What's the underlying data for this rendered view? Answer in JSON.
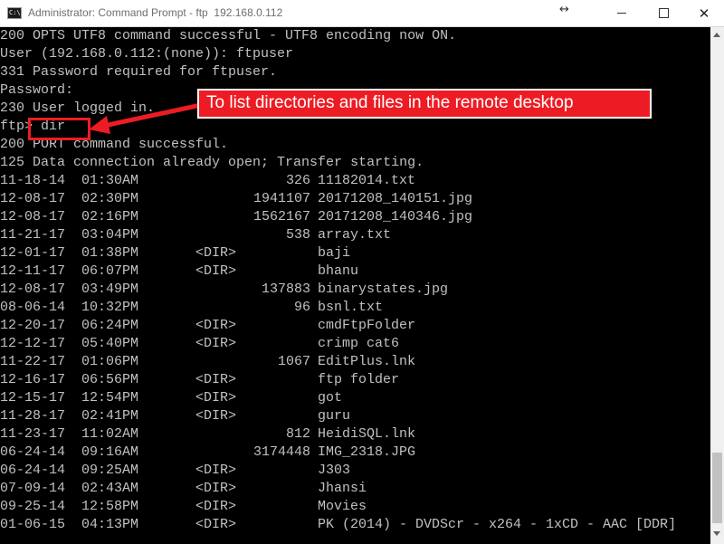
{
  "window": {
    "title": "Administrator: Command Prompt - ftp  192.168.0.112",
    "resize_icon": "↔",
    "icons": {
      "app": "cmd-app-icon",
      "minimize": "minimize-icon",
      "maximize": "maximize-icon",
      "close": "close-icon"
    },
    "close_glyph": "✕"
  },
  "console": {
    "lines": [
      "200 OPTS UTF8 command successful - UTF8 encoding now ON.",
      "User (192.168.0.112:(none)): ftpuser",
      "331 Password required for ftpuser.",
      "Password:",
      "230 User logged in.",
      "ftp> dir",
      "200 PORT command successful.",
      "125 Data connection already open; Transfer starting."
    ],
    "listing": [
      {
        "date": "11-18-14",
        "time": "01:30AM",
        "dir": "",
        "size": "326",
        "name": "11182014.txt"
      },
      {
        "date": "12-08-17",
        "time": "02:30PM",
        "dir": "",
        "size": "1941107",
        "name": "20171208_140151.jpg"
      },
      {
        "date": "12-08-17",
        "time": "02:16PM",
        "dir": "",
        "size": "1562167",
        "name": "20171208_140346.jpg"
      },
      {
        "date": "11-21-17",
        "time": "03:04PM",
        "dir": "",
        "size": "538",
        "name": "array.txt"
      },
      {
        "date": "12-01-17",
        "time": "01:38PM",
        "dir": "<DIR>",
        "size": "",
        "name": "baji"
      },
      {
        "date": "12-11-17",
        "time": "06:07PM",
        "dir": "<DIR>",
        "size": "",
        "name": "bhanu"
      },
      {
        "date": "12-08-17",
        "time": "03:49PM",
        "dir": "",
        "size": "137883",
        "name": "binarystates.jpg"
      },
      {
        "date": "08-06-14",
        "time": "10:32PM",
        "dir": "",
        "size": "96",
        "name": "bsnl.txt"
      },
      {
        "date": "12-20-17",
        "time": "06:24PM",
        "dir": "<DIR>",
        "size": "",
        "name": "cmdFtpFolder"
      },
      {
        "date": "12-12-17",
        "time": "05:40PM",
        "dir": "<DIR>",
        "size": "",
        "name": "crimp cat6"
      },
      {
        "date": "11-22-17",
        "time": "01:06PM",
        "dir": "",
        "size": "1067",
        "name": "EditPlus.lnk"
      },
      {
        "date": "12-16-17",
        "time": "06:56PM",
        "dir": "<DIR>",
        "size": "",
        "name": "ftp folder"
      },
      {
        "date": "12-15-17",
        "time": "12:54PM",
        "dir": "<DIR>",
        "size": "",
        "name": "got"
      },
      {
        "date": "11-28-17",
        "time": "02:41PM",
        "dir": "<DIR>",
        "size": "",
        "name": "guru"
      },
      {
        "date": "11-23-17",
        "time": "11:02AM",
        "dir": "",
        "size": "812",
        "name": "HeidiSQL.lnk"
      },
      {
        "date": "06-24-14",
        "time": "09:16AM",
        "dir": "",
        "size": "3174448",
        "name": "IMG_2318.JPG"
      },
      {
        "date": "06-24-14",
        "time": "09:25AM",
        "dir": "<DIR>",
        "size": "",
        "name": "J303"
      },
      {
        "date": "07-09-14",
        "time": "02:43AM",
        "dir": "<DIR>",
        "size": "",
        "name": "Jhansi"
      },
      {
        "date": "09-25-14",
        "time": "12:58PM",
        "dir": "<DIR>",
        "size": "",
        "name": "Movies"
      },
      {
        "date": "01-06-15",
        "time": "04:13PM",
        "dir": "<DIR>",
        "size": "",
        "name": "PK (2014) - DVDScr - x264 - 1xCD - AAC [DDR]"
      }
    ]
  },
  "annotation": {
    "text": "To list directories and files in the remote desktop",
    "color": "#ed1c24"
  },
  "colors": {
    "console_bg": "#000000",
    "console_fg": "#c0c0c0"
  }
}
